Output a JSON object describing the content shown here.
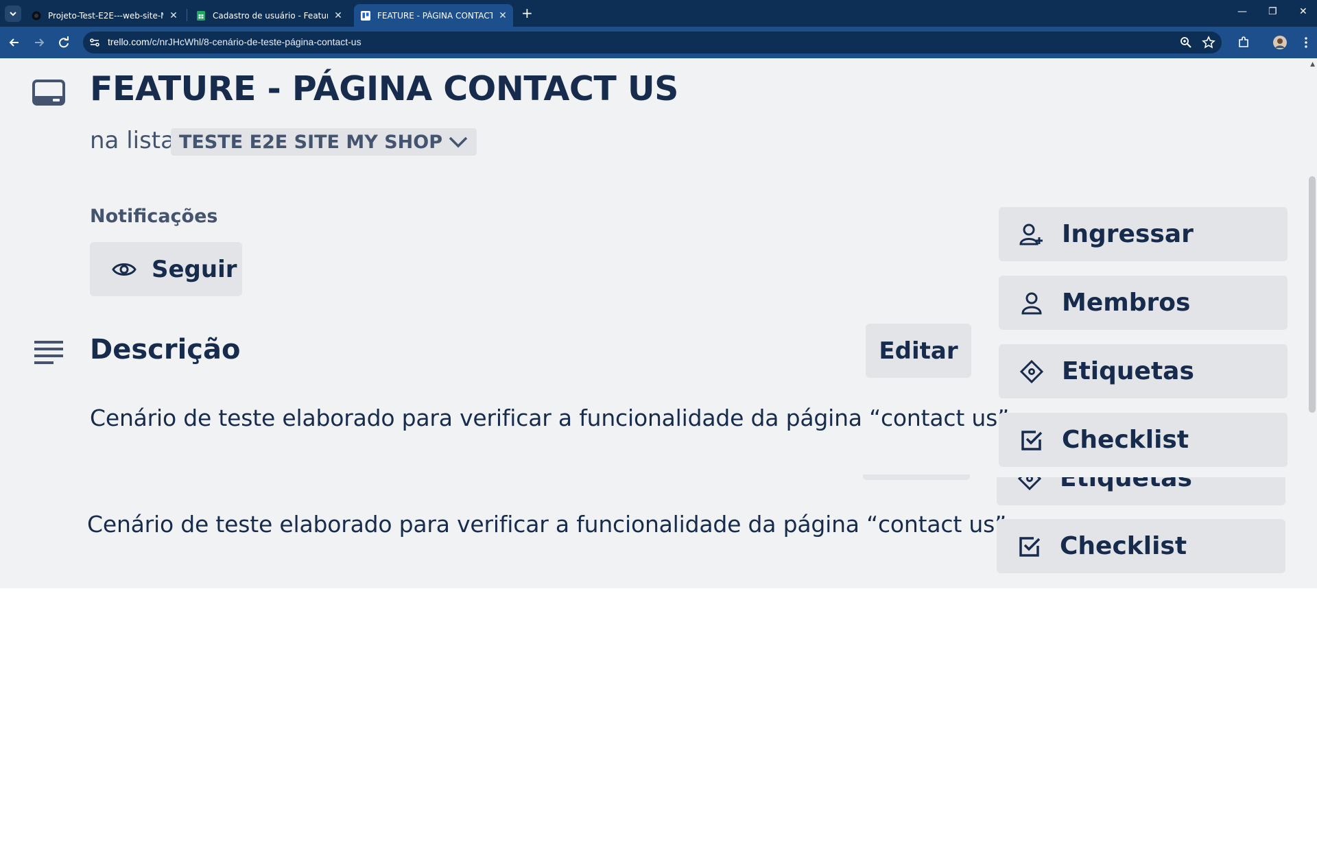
{
  "browser": {
    "tabs": [
      {
        "title": "Projeto-Test-E2E---web-site-My",
        "active": false
      },
      {
        "title": "Cadastro de usuário - Feature -",
        "active": false
      },
      {
        "title": "FEATURE - PÁGINA CONTACT U",
        "active": true
      }
    ],
    "url_host": "trello.com",
    "url_path": "/c/nrJHcWhl/8-cenário-de-teste-página-contact-us"
  },
  "card": {
    "title": "FEATURE - PÁGINA CONTACT US",
    "list_prefix": "na lista",
    "list_name": "TESTE E2E SITE MY SHOP",
    "notifications_label": "Notificações",
    "follow_label": "Seguir",
    "description_title": "Descrição",
    "edit_label": "Editar",
    "description_text": "Cenário de teste elaborado para verificar a funcionalidade da página “contact us”."
  },
  "sidebar": {
    "items": [
      {
        "label": "Ingressar",
        "icon": "add-person-icon"
      },
      {
        "label": "Membros",
        "icon": "person-icon"
      },
      {
        "label": "Etiquetas",
        "icon": "tag-icon"
      },
      {
        "label": "Checklist",
        "icon": "checkbox-icon"
      }
    ]
  },
  "colors": {
    "chrome_dark": "#0d2f56",
    "chrome_toolbar": "#1c4f8b",
    "page_bg": "#f1f2f4",
    "button_bg": "#e2e4e8",
    "text_primary": "#172b4d",
    "text_secondary": "#44546f"
  }
}
